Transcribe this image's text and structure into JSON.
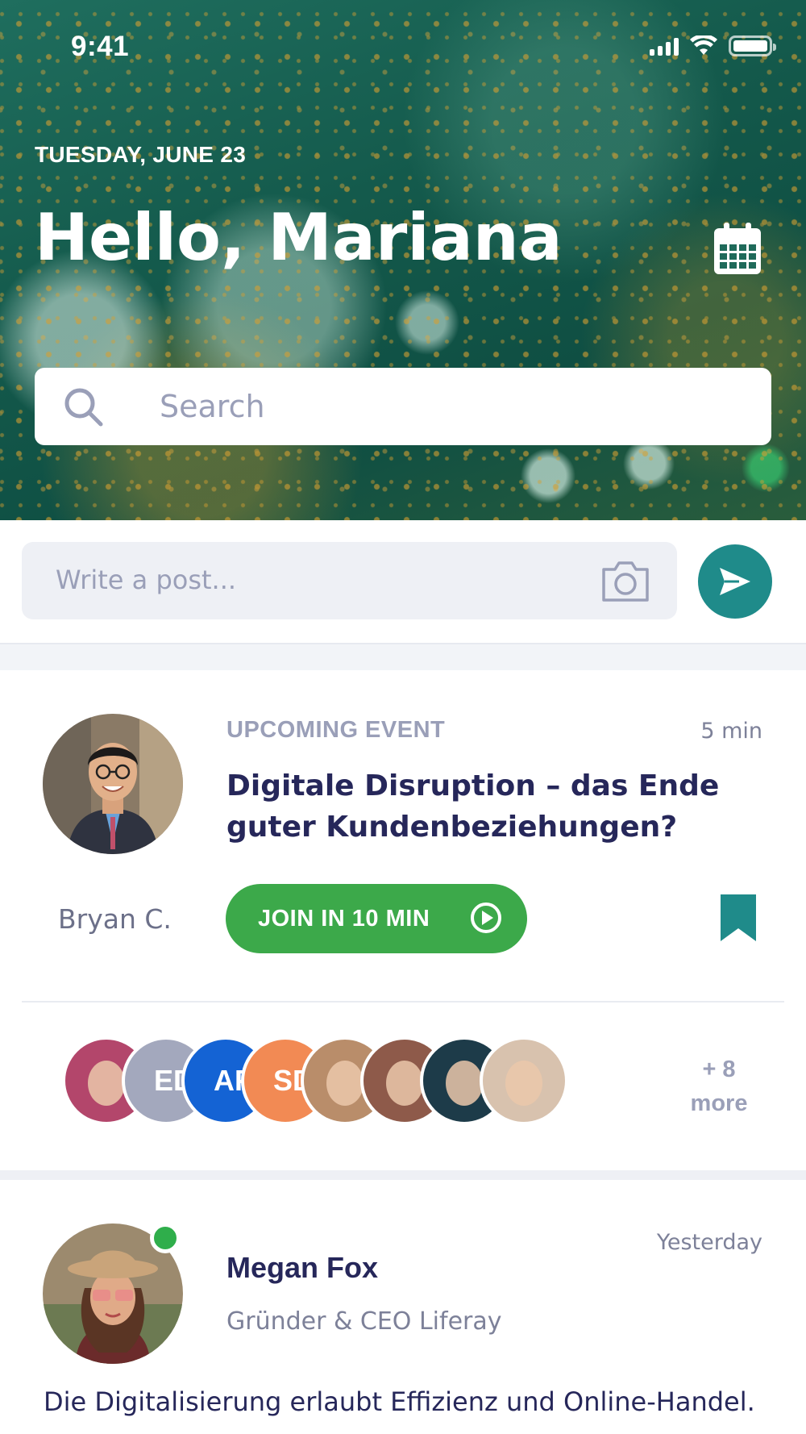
{
  "status_bar": {
    "time": "9:41"
  },
  "header": {
    "date": "TUESDAY, JUNE 23",
    "greeting": "Hello, Mariana"
  },
  "search": {
    "placeholder": "Search"
  },
  "composer": {
    "placeholder": "Write a post..."
  },
  "event": {
    "label": "UPCOMING EVENT",
    "time": "5 min",
    "title": "Digitale Disruption – das Ende guter Kundenbeziehungen?",
    "host": "Bryan C.",
    "join_label": "JOIN IN 10 MIN",
    "attendees": [
      {
        "type": "photo",
        "color": "#b3466b"
      },
      {
        "type": "initials",
        "initials": "ED",
        "color": "#a3a8bd"
      },
      {
        "type": "initials",
        "initials": "AP",
        "color": "#1463d4"
      },
      {
        "type": "initials",
        "initials": "SD",
        "color": "#f28a54"
      },
      {
        "type": "photo",
        "color": "#b98d6a"
      },
      {
        "type": "photo",
        "color": "#8e5a4a"
      },
      {
        "type": "photo",
        "color": "#1d3b49"
      },
      {
        "type": "photo",
        "color": "#d8c2ae"
      }
    ],
    "more_count": "+ 8",
    "more_label": "more"
  },
  "post": {
    "author": "Megan Fox",
    "role": "Gründer & CEO Liferay",
    "time": "Yesterday",
    "body": "Die Digitalisierung erlaubt Effizienz und Online-Handel."
  },
  "colors": {
    "accent_teal": "#1f8b8a",
    "join_green": "#3ca94a",
    "online_green": "#2fae4b",
    "text_primary": "#26275a",
    "text_muted": "#9a9fb8"
  },
  "icons": [
    "calendar-icon",
    "search-icon",
    "camera-icon",
    "send-icon",
    "play-icon",
    "bookmark-icon",
    "wifi-icon",
    "signal-icon",
    "battery-icon"
  ]
}
